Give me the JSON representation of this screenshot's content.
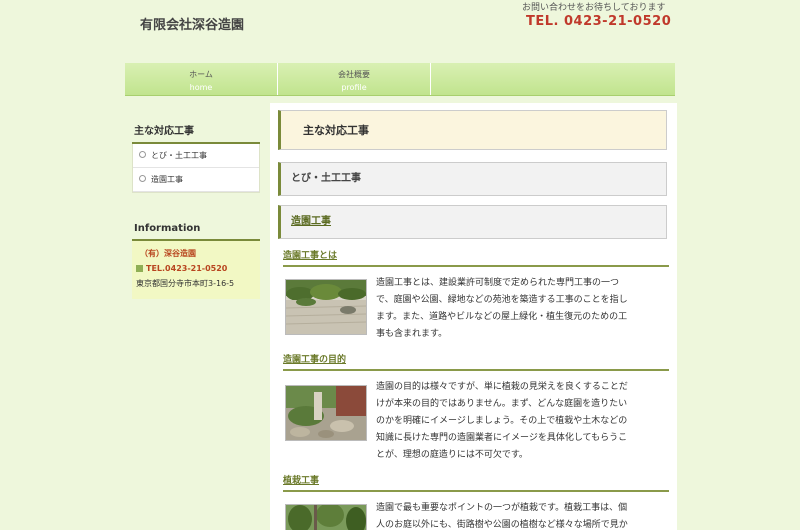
{
  "header": {
    "site_title": "有限会社深谷造園",
    "contact_note": "お問い合わせをお待ちしております",
    "phone": "TEL. 0423-21-0520"
  },
  "nav": {
    "items": [
      {
        "label": "ホーム",
        "sub": "home"
      },
      {
        "label": "会社概要",
        "sub": "profile"
      }
    ]
  },
  "sidebar": {
    "menu_heading": "主な対応工事",
    "menu_items": [
      "とび・土工工事",
      "造園工事"
    ],
    "info_heading": "Information",
    "info": {
      "company": "（有）深谷造園",
      "tel": "TEL.0423-21-0520",
      "address": "東京都国分寺市本町3-16-5"
    }
  },
  "main": {
    "title": "主な対応工事",
    "section1": "とび・土工工事",
    "section2": "造園工事",
    "entries": [
      {
        "heading": "造園工事とは",
        "lines": [
          "造園工事とは、建設業許可制度で定められた専門工事の一つ",
          "で、庭園や公園、緑地などの苑池を築造する工事のことを指し",
          "ます。また、道路やビルなどの屋上緑化・植生復元のための工",
          "事も含まれます。"
        ]
      },
      {
        "heading": "造園工事の目的",
        "lines": [
          "造園の目的は様々ですが、単に植栽の見栄えを良くすることだ",
          "けが本来の目的ではありません。まず、どんな庭園を造りたい",
          "のかを明確にイメージしましょう。その上で植栽や土木などの",
          "知識に長けた専門の造園業者にイメージを具体化してもらうこ",
          "とが、理想の庭造りには不可欠です。"
        ]
      },
      {
        "heading": "植栽工事",
        "lines": [
          "造園で最も重要なポイントの一つが植栽です。植栽工事は、個",
          "人のお庭以外にも、街路樹や公園の植樹など様々な場所で見か"
        ]
      }
    ]
  }
}
